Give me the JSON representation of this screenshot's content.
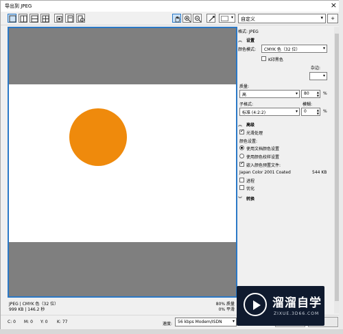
{
  "window": {
    "title": "导出到 JPEG",
    "close_glyph": "×"
  },
  "toolbar": {
    "preset_value": "自定义",
    "add_glyph": "+",
    "view_buttons": [
      "full-view-icon",
      "split-vertical-icon",
      "split-horizontal-icon",
      "quad-view-icon"
    ],
    "tool_buttons": [
      "fit-icon",
      "hand-icon",
      "zoom-in-icon",
      "zoom-out-icon",
      "eyedropper-icon"
    ]
  },
  "preview": {
    "circle_color": "#ef8a0c",
    "gray_color": "#7f7f7f"
  },
  "status": {
    "line1_left": "JPEG  |  CMYK 色（32 位）",
    "line2_left": "999 KB  |  146.2 秒",
    "line1_right": "80% 质量",
    "line2_right": "0% 平滑"
  },
  "bottom": {
    "c": "C: 0",
    "m": "M: 0",
    "y": "Y: 0",
    "k": "K: 77",
    "speed_label": "速度:",
    "speed_value": "56 kbps Modem/ISDN"
  },
  "panel": {
    "format": "格式: JPEG",
    "settings_title": "设置",
    "color_mode_label": "颜色模式:",
    "color_mode_value": "CMYK 色（32 位）",
    "print_black": "K印黑色",
    "matte_label": "杂边:",
    "quality_label": "质量:",
    "quality_value": "高",
    "quality_number": "80",
    "percent": "%",
    "subformat_label": "子格式:",
    "subformat_value": "标准 (4:2:2)",
    "blur_label": "模糊:",
    "blur_number": "0",
    "advanced_title": "高级",
    "anti_alias": "光滑处理",
    "color_settings_label": "颜色设置:",
    "use_doc_color": "使用文档颜色设置",
    "use_proof_color": "使用颜色校样设置",
    "embed_profile": "嵌入颜色预置文件:",
    "profile_name": "Japan Color 2001 Coated",
    "profile_size": "544 KB",
    "progressive": "进程",
    "optimize": "优化",
    "transform_title": "转换"
  },
  "watermark": {
    "brand": "溜溜自学",
    "url": "ZIXUE.3D66.COM"
  }
}
